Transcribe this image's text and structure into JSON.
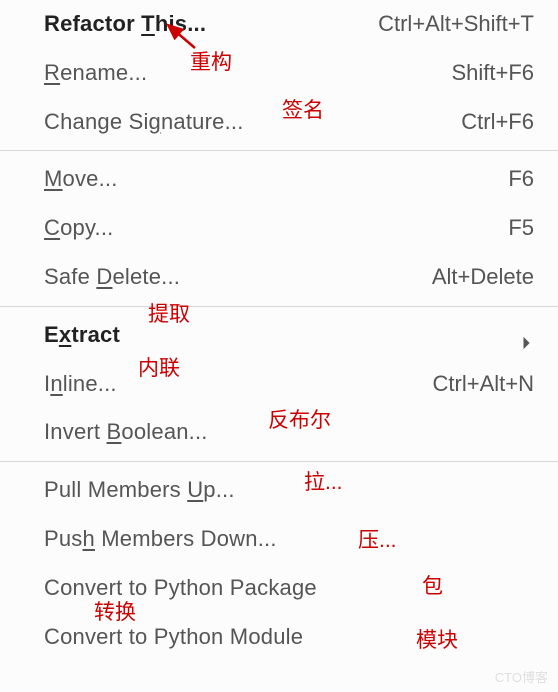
{
  "menu": {
    "groups": [
      [
        {
          "label_pre": "",
          "mnemonic": "T",
          "label_post": "his...",
          "prefix": "Refactor ",
          "shortcut": "Ctrl+Alt+Shift+T",
          "bold": true,
          "arrow": false
        },
        {
          "label_pre": "",
          "mnemonic": "R",
          "label_post": "ename...",
          "prefix": "",
          "shortcut": "Shift+F6",
          "bold": false,
          "arrow": false
        },
        {
          "label_pre": "Change Si",
          "mnemonic": "g",
          "label_post": "nature...",
          "prefix": "",
          "shortcut": "Ctrl+F6",
          "bold": false,
          "arrow": false
        }
      ],
      [
        {
          "label_pre": "",
          "mnemonic": "M",
          "label_post": "ove...",
          "prefix": "",
          "shortcut": "F6",
          "bold": false,
          "arrow": false
        },
        {
          "label_pre": "",
          "mnemonic": "C",
          "label_post": "opy...",
          "prefix": "",
          "shortcut": "F5",
          "bold": false,
          "arrow": false
        },
        {
          "label_pre": "Safe ",
          "mnemonic": "D",
          "label_post": "elete...",
          "prefix": "",
          "shortcut": "Alt+Delete",
          "bold": false,
          "arrow": false
        }
      ],
      [
        {
          "label_pre": "E",
          "mnemonic": "x",
          "label_post": "tract",
          "prefix": "",
          "shortcut": "",
          "bold": true,
          "arrow": true
        },
        {
          "label_pre": "I",
          "mnemonic": "n",
          "label_post": "line...",
          "prefix": "",
          "shortcut": "Ctrl+Alt+N",
          "bold": false,
          "arrow": false
        },
        {
          "label_pre": "Invert ",
          "mnemonic": "B",
          "label_post": "oolean...",
          "prefix": "",
          "shortcut": "",
          "bold": false,
          "arrow": false
        }
      ],
      [
        {
          "label_pre": "Pull Members ",
          "mnemonic": "U",
          "label_post": "p...",
          "prefix": "",
          "shortcut": "",
          "bold": false,
          "arrow": false
        },
        {
          "label_pre": "Pus",
          "mnemonic": "h",
          "label_post": " Members Down...",
          "prefix": "",
          "shortcut": "",
          "bold": false,
          "arrow": false
        },
        {
          "label_pre": "Convert to Python Package",
          "mnemonic": "",
          "label_post": "",
          "prefix": "",
          "shortcut": "",
          "bold": false,
          "arrow": false
        },
        {
          "label_pre": "Convert to Python Module",
          "mnemonic": "",
          "label_post": "",
          "prefix": "",
          "shortcut": "",
          "bold": false,
          "arrow": false
        }
      ]
    ]
  },
  "annotations": {
    "a1": "重构",
    "a2": "签名",
    "a3": "提取",
    "a4": "内联",
    "a5": "反布尔",
    "a6": "拉...",
    "a7": "压...",
    "a8": "转换",
    "a9": "包",
    "a10": "模块"
  },
  "watermark": "CTO博客"
}
